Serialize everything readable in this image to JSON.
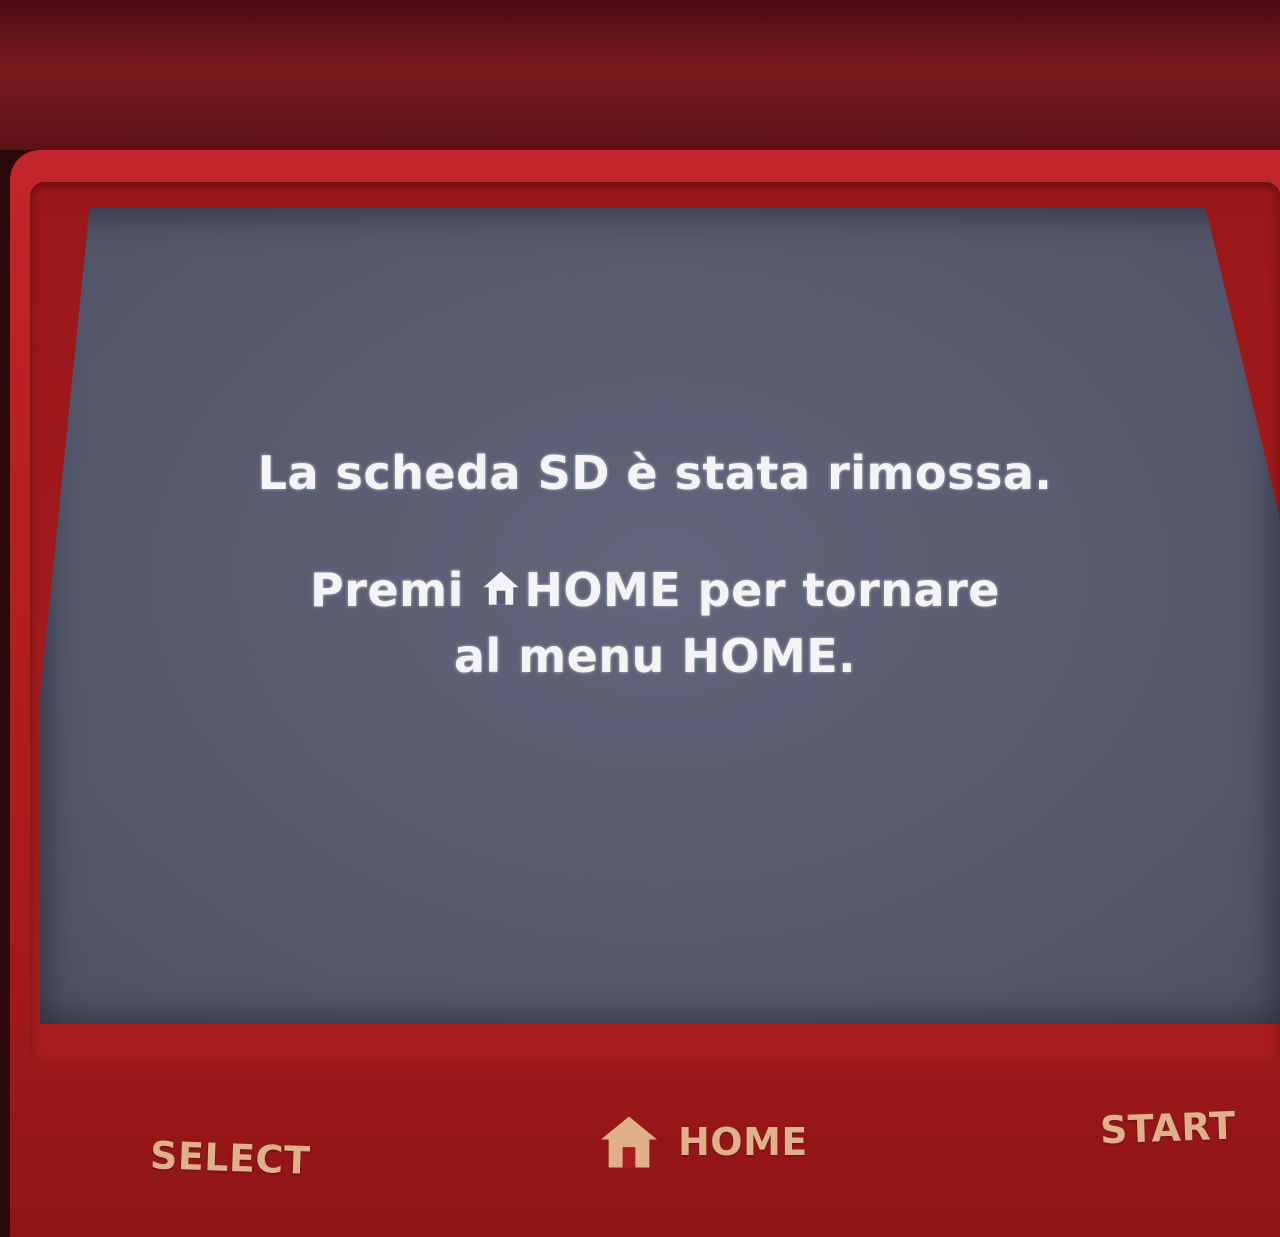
{
  "screen": {
    "line1": "La scheda SD è stata rimossa.",
    "line2_before": "Premi ",
    "line2_after": "HOME per tornare",
    "line3": "al menu HOME."
  },
  "buttons": {
    "select": "SELECT",
    "home": "HOME",
    "start": "START"
  },
  "icons": {
    "home": "home-icon"
  },
  "colors": {
    "shell_red": "#b3201f",
    "screen_bg": "#5a5d72",
    "screen_text": "#f4f4f6",
    "button_label": "#e0b08a"
  }
}
